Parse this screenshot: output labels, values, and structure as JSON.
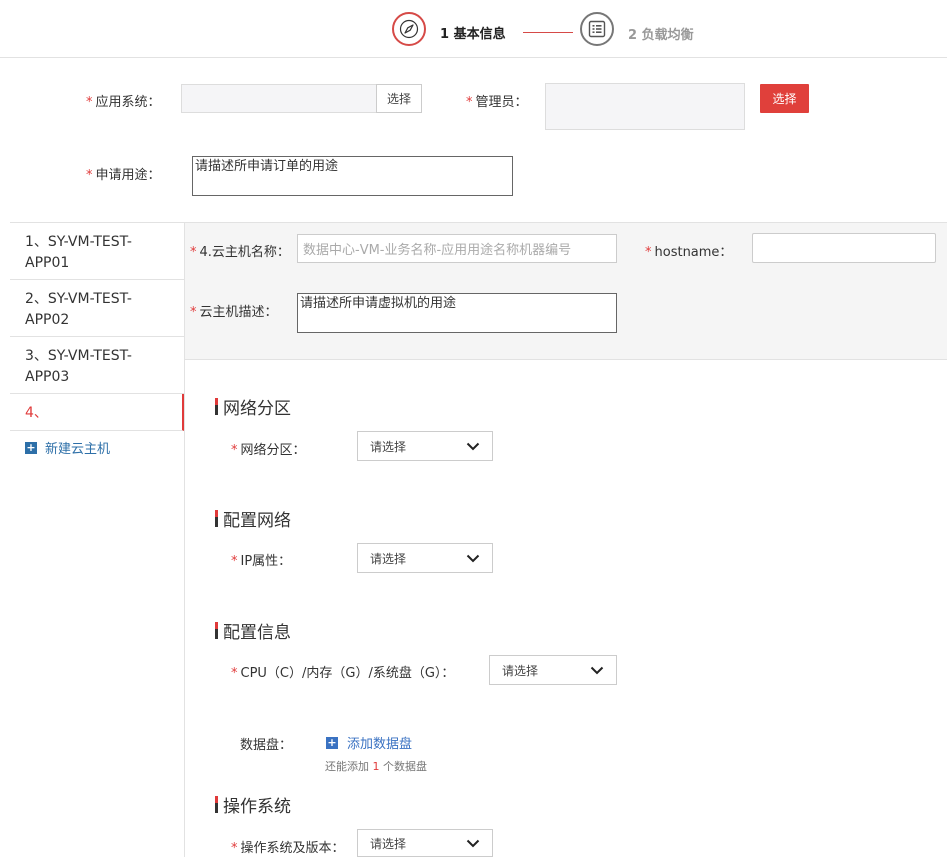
{
  "steps": [
    {
      "label": "1 基本信息",
      "state": "active",
      "icon": "compass-icon"
    },
    {
      "label": "2 负载均衡",
      "state": "inactive",
      "icon": "list-icon"
    }
  ],
  "form": {
    "app_system": {
      "label": "应用系统：",
      "value": "",
      "button": "选择"
    },
    "admin": {
      "label": "管理员：",
      "value": "",
      "button": "选择"
    },
    "purpose": {
      "label": "申请用途：",
      "value": "请描述所申请订单的用途"
    }
  },
  "vm_list": {
    "items": [
      {
        "label": "1、SY-VM-TEST-APP01",
        "line1": "1、SY-VM-TEST-",
        "line2": "APP01"
      },
      {
        "label": "2、SY-VM-TEST-APP02",
        "line1": "2、SY-VM-TEST-",
        "line2": "APP02"
      },
      {
        "label": "3、SY-VM-TEST-APP03",
        "line1": "3、SY-VM-TEST-",
        "line2": "APP03"
      },
      {
        "label": "4、",
        "line1": "4、",
        "line2": "",
        "active": true
      }
    ],
    "new_label": "新建云主机"
  },
  "vm_form": {
    "name": {
      "label": "4.云主机名称：",
      "placeholder": "数据中心-VM-业务名称-应用用途名称机器编号"
    },
    "hostname": {
      "label": "hostname：",
      "value": ""
    },
    "desc": {
      "label": "云主机描述：",
      "value": "请描述所申请虚拟机的用途"
    }
  },
  "sections": {
    "network_zone": {
      "title": "网络分区",
      "field_label": "网络分区：",
      "select": "请选择"
    },
    "network_config": {
      "title": "配置网络",
      "field_label": "IP属性：",
      "select": "请选择"
    },
    "config_info": {
      "title": "配置信息",
      "field_label": "CPU（C）/内存（G）/系统盘（G）：",
      "select": "请选择"
    },
    "data_disk": {
      "label": "数据盘：",
      "add_label": "添加数据盘",
      "note_prefix": "还能添加",
      "note_count": "1",
      "note_suffix": "个数据盘"
    },
    "os": {
      "title": "操作系统",
      "field_label": "操作系统及版本：",
      "select": "请选择"
    }
  },
  "colors": {
    "accent": "#e03a3a",
    "link": "#2d6fa8",
    "panel": "#f5f5f5"
  }
}
